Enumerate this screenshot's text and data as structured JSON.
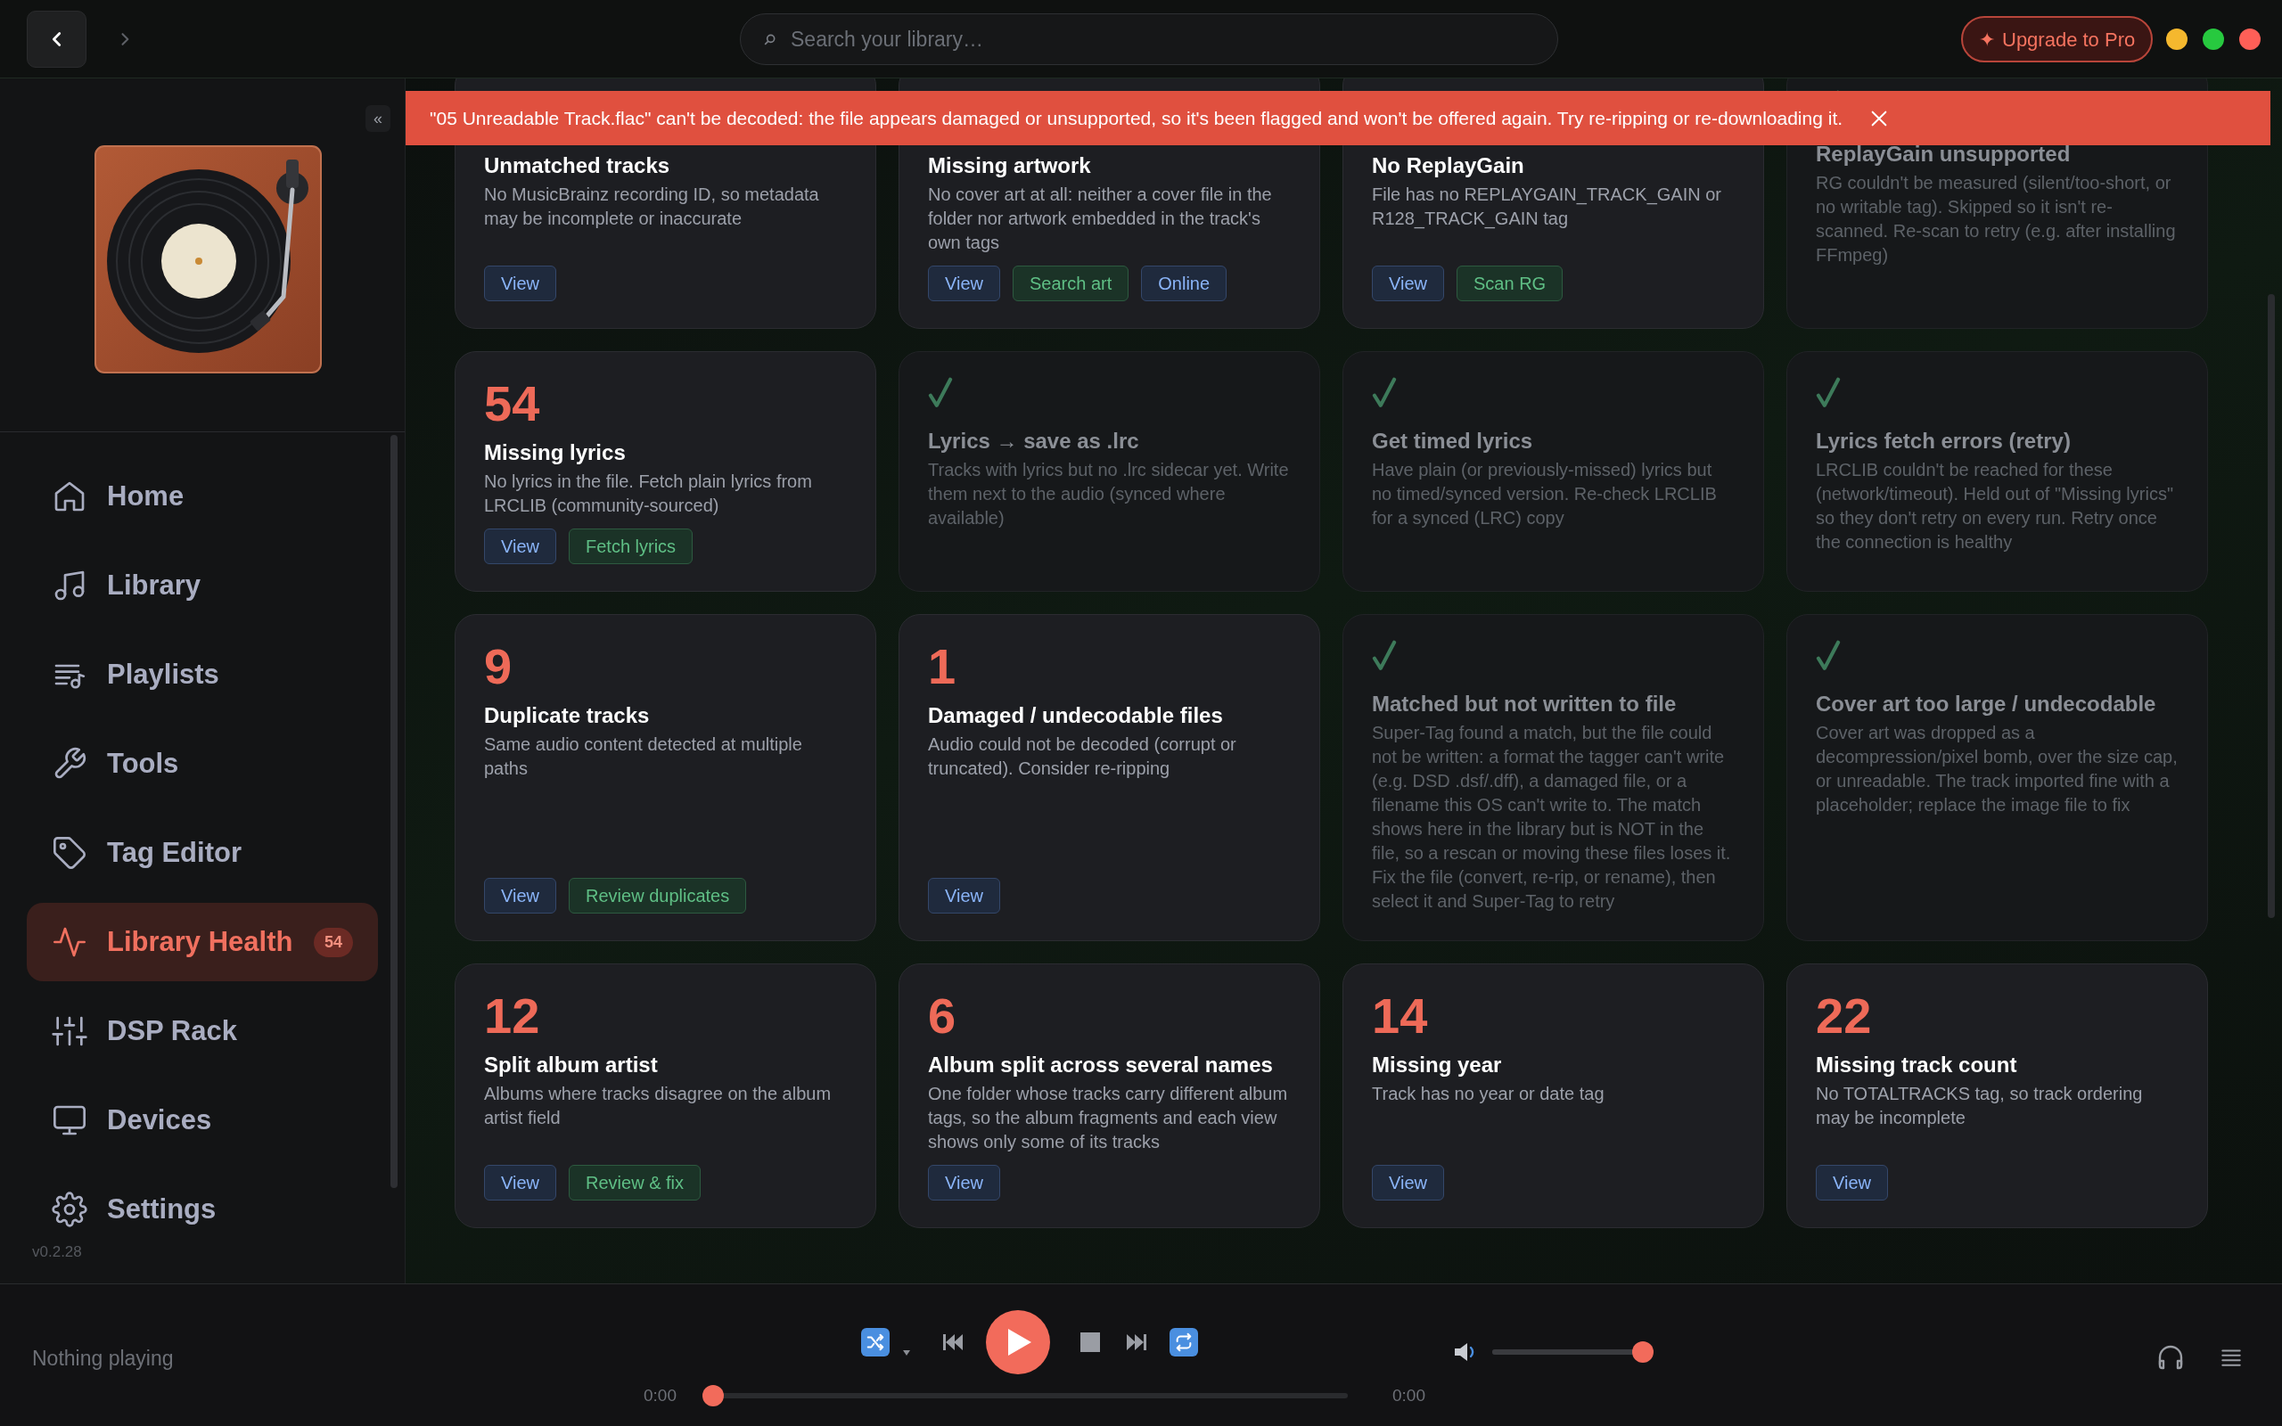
{
  "toolbar": {
    "search": {
      "placeholder": "Search your library…"
    },
    "upgrade": {
      "icon": "✦",
      "label": "Upgrade to Pro"
    }
  },
  "sidebar": {
    "collapse_label": "«",
    "items": [
      {
        "label": "Home",
        "selected": false
      },
      {
        "label": "Library",
        "selected": false
      },
      {
        "label": "Playlists",
        "selected": false
      },
      {
        "label": "Tools",
        "selected": false
      },
      {
        "label": "Tag Editor",
        "selected": false
      },
      {
        "label": "Library Health",
        "selected": true,
        "badge": "54"
      },
      {
        "label": "DSP Rack",
        "selected": false
      },
      {
        "label": "Devices",
        "selected": false
      },
      {
        "label": "Settings",
        "selected": false
      }
    ],
    "version": "v0.2.28"
  },
  "banner": {
    "message": "\"05 Unreadable Track.flac\" can't be decoded: the file appears damaged or unsupported, so it's been flagged and won't be offered again. Try re-ripping or re-downloading it."
  },
  "cards": [
    {
      "title": "Unmatched tracks",
      "description": "No MusicBrainz recording ID, so metadata may be incomplete or inaccurate",
      "resolved": false,
      "buttons": [
        {
          "label": "View",
          "kind": "navigate"
        }
      ]
    },
    {
      "title": "Missing artwork",
      "description": "No cover art at all: neither a cover file in the folder nor artwork embedded in the track's own tags",
      "resolved": false,
      "buttons": [
        {
          "label": "View",
          "kind": "navigate"
        },
        {
          "label": "Search art",
          "kind": "action"
        },
        {
          "label": "Online",
          "kind": "navigate"
        }
      ]
    },
    {
      "title": "No ReplayGain",
      "description": "File has no REPLAYGAIN_TRACK_GAIN or R128_TRACK_GAIN tag",
      "resolved": false,
      "buttons": [
        {
          "label": "View",
          "kind": "navigate"
        },
        {
          "label": "Scan RG",
          "kind": "action"
        }
      ]
    },
    {
      "title": "ReplayGain unsupported",
      "description": "RG couldn't be measured (silent/too-short, or no writable tag). Skipped so it isn't re-scanned. Re-scan to retry (e.g. after installing FFmpeg)",
      "resolved": true
    },
    {
      "count": "54",
      "title": "Missing lyrics",
      "description": "No lyrics in the file. Fetch plain lyrics from LRCLIB (community-sourced)",
      "resolved": false,
      "buttons": [
        {
          "label": "View",
          "kind": "navigate"
        },
        {
          "label": "Fetch lyrics",
          "kind": "action"
        }
      ]
    },
    {
      "title": "Lyrics → save as .lrc",
      "description": "Tracks with lyrics but no .lrc sidecar yet. Write them next to the audio (synced where available)",
      "resolved": true
    },
    {
      "title": "Get timed lyrics",
      "description": "Have plain (or previously-missed) lyrics but no timed/synced version. Re-check LRCLIB for a synced (LRC) copy",
      "resolved": true
    },
    {
      "title": "Lyrics fetch errors (retry)",
      "description": "LRCLIB couldn't be reached for these (network/timeout). Held out of \"Missing lyrics\" so they don't retry on every run. Retry once the connection is healthy",
      "resolved": true
    },
    {
      "count": "9",
      "title": "Duplicate tracks",
      "description": "Same audio content detected at multiple paths",
      "resolved": false,
      "buttons": [
        {
          "label": "View",
          "kind": "navigate"
        },
        {
          "label": "Review duplicates",
          "kind": "action"
        }
      ]
    },
    {
      "count": "1",
      "title": "Damaged / undecodable files",
      "description": "Audio could not be decoded (corrupt or truncated). Consider re-ripping",
      "resolved": false,
      "buttons": [
        {
          "label": "View",
          "kind": "navigate"
        }
      ]
    },
    {
      "title": "Matched but not written to file",
      "description": "Super-Tag found a match, but the file could not be written: a format the tagger can't write (e.g. DSD .dsf/.dff), a damaged file, or a filename this OS can't write to. The match shows here in the library but is NOT in the file, so a rescan or moving these files loses it. Fix the file (convert, re-rip, or rename), then select it and Super-Tag to retry",
      "resolved": true
    },
    {
      "title": "Cover art too large / undecodable",
      "description": "Cover art was dropped as a decompression/pixel bomb, over the size cap, or unreadable. The track imported fine with a placeholder; replace the image file to fix",
      "resolved": true
    },
    {
      "count": "12",
      "title": "Split album artist",
      "description": "Albums where tracks disagree on the album artist field",
      "resolved": false,
      "buttons": [
        {
          "label": "View",
          "kind": "navigate"
        },
        {
          "label": "Review & fix",
          "kind": "action"
        }
      ]
    },
    {
      "count": "6",
      "title": "Album split across several names",
      "description": "One folder whose tracks carry different album tags, so the album fragments and each view shows only some of its tracks",
      "resolved": false,
      "buttons": [
        {
          "label": "View",
          "kind": "navigate"
        }
      ]
    },
    {
      "count": "14",
      "title": "Missing year",
      "description": "Track has no year or date tag",
      "resolved": false,
      "buttons": [
        {
          "label": "View",
          "kind": "navigate"
        }
      ]
    },
    {
      "count": "22",
      "title": "Missing track count",
      "description": "No TOTALTRACKS tag, so track ordering may be incomplete",
      "resolved": false,
      "buttons": [
        {
          "label": "View",
          "kind": "navigate"
        }
      ]
    }
  ],
  "player": {
    "now_playing": "Nothing playing",
    "shuffle": {
      "on": true
    },
    "repeat": {
      "on": true
    },
    "elapsed": "0:00",
    "total": "0:00",
    "progress": {
      "level": 0
    },
    "volume": {
      "level": 1
    }
  }
}
